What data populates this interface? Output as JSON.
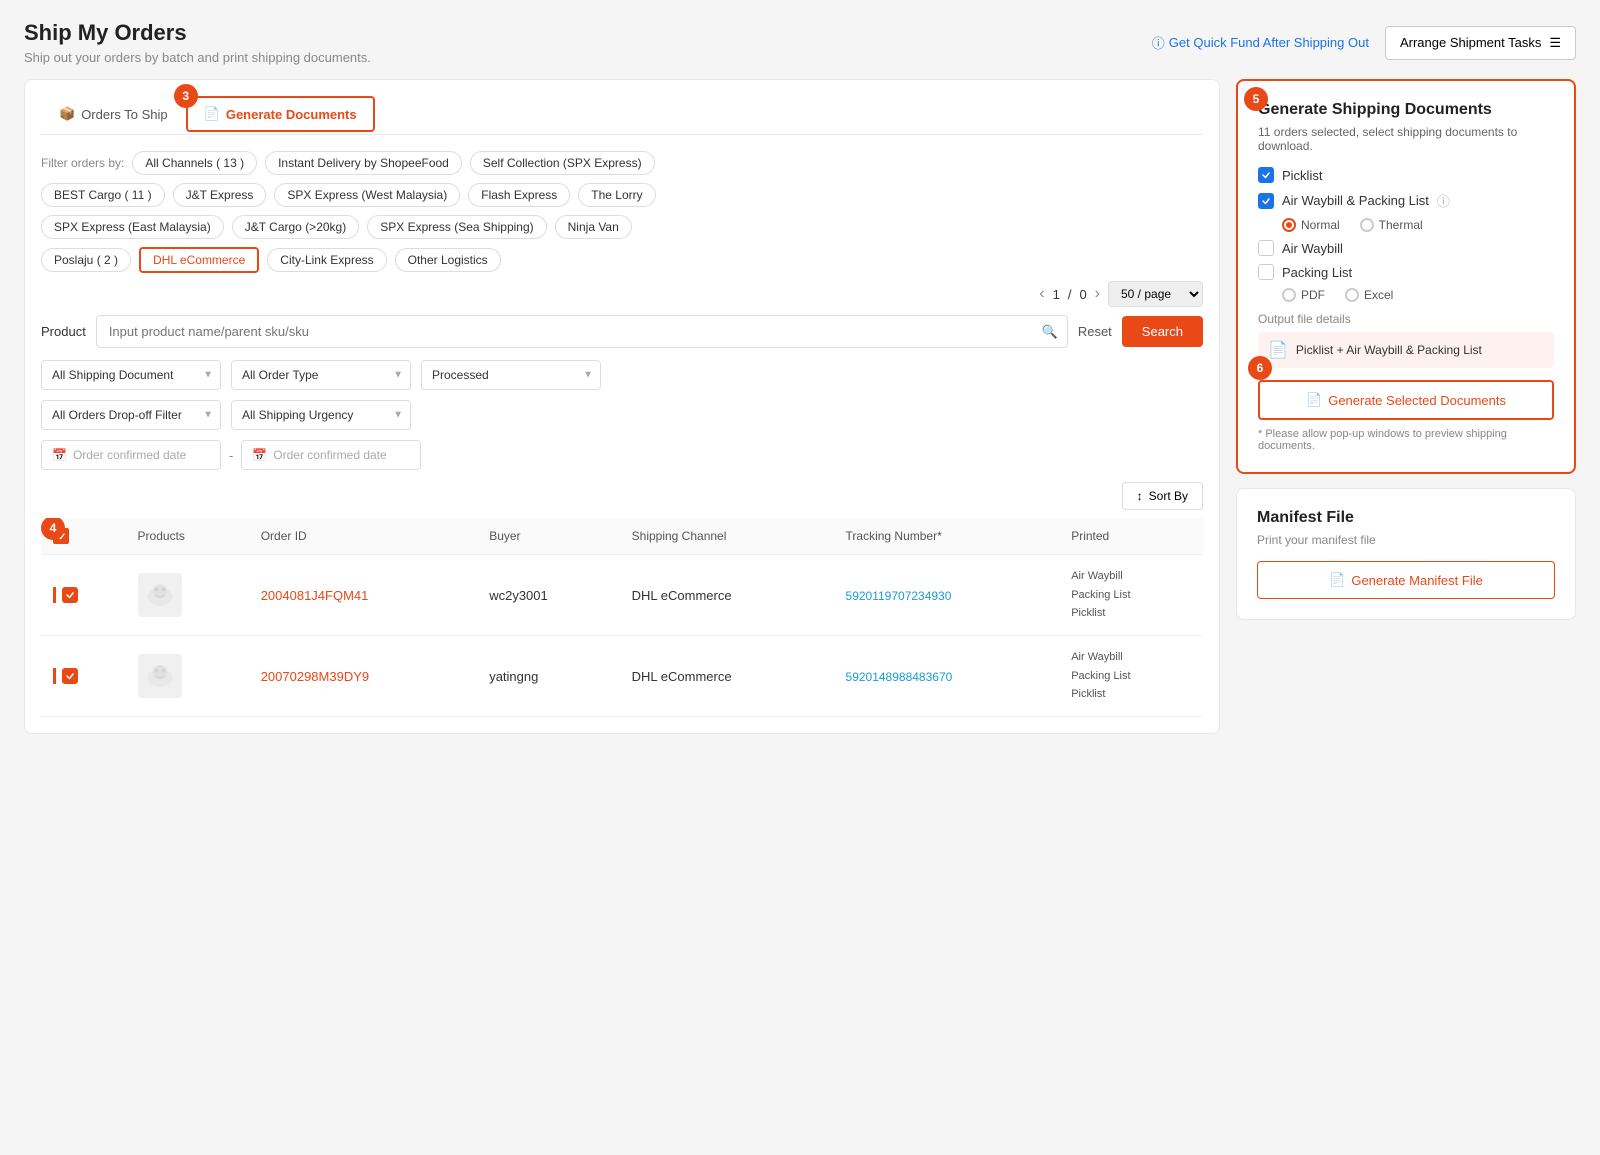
{
  "page": {
    "title": "Ship My Orders",
    "subtitle": "Ship out your orders by batch and print shipping documents.",
    "get_quick_fund": "Get Quick Fund After Shipping Out",
    "arrange_btn": "Arrange Shipment Tasks"
  },
  "tabs": [
    {
      "id": "orders-to-ship",
      "label": "Orders To Ship",
      "icon": "box-icon",
      "active": false
    },
    {
      "id": "generate-documents",
      "label": "Generate Documents",
      "icon": "doc-icon",
      "active": true
    }
  ],
  "filters": {
    "label": "Filter orders by:",
    "chips": [
      {
        "label": "All Channels ( 13 )",
        "active": false
      },
      {
        "label": "Instant Delivery by ShopeeFood",
        "active": false
      },
      {
        "label": "Self Collection (SPX Express)",
        "active": false
      },
      {
        "label": "BEST Cargo ( 11 )",
        "active": false
      },
      {
        "label": "J&T Express",
        "active": false
      },
      {
        "label": "SPX Express (West Malaysia)",
        "active": false
      },
      {
        "label": "Flash Express",
        "active": false
      },
      {
        "label": "The Lorry",
        "active": false
      },
      {
        "label": "SPX Express (East Malaysia)",
        "active": false
      },
      {
        "label": "J&T Cargo (>20kg)",
        "active": false
      },
      {
        "label": "SPX Express (Sea Shipping)",
        "active": false
      },
      {
        "label": "Ninja Van",
        "active": false
      },
      {
        "label": "Poslaju ( 2 )",
        "active": false
      },
      {
        "label": "DHL eCommerce",
        "active": true
      },
      {
        "label": "City-Link Express",
        "active": false
      },
      {
        "label": "Other Logistics",
        "active": false
      }
    ]
  },
  "pagination": {
    "current": "1",
    "total": "0",
    "per_page": "50 / page"
  },
  "search": {
    "label": "Product",
    "placeholder": "Input product name/parent sku/sku",
    "reset_label": "Reset",
    "search_label": "Search"
  },
  "dropdowns": {
    "shipping_doc": "All Shipping Document",
    "order_type": "All Order Type",
    "status": "Processed",
    "dropoff_filter": "All Orders Drop-off Filter",
    "shipping_urgency": "All Shipping Urgency"
  },
  "date": {
    "from_placeholder": "Order confirmed date",
    "to_placeholder": "Order confirmed date"
  },
  "sort_label": "Sort By",
  "table": {
    "headers": [
      "",
      "Products",
      "Order ID",
      "Buyer",
      "Shipping Channel",
      "Tracking Number*",
      "Printed"
    ],
    "rows": [
      {
        "id": "row-1",
        "order_id": "2004081J4FQM41",
        "buyer": "wc2y3001",
        "channel": "DHL eCommerce",
        "tracking": "5920119707234930",
        "printed": [
          "Air Waybill",
          "Packing List",
          "Picklist"
        ],
        "has_image": true
      },
      {
        "id": "row-2",
        "order_id": "20070298M39DY9",
        "buyer": "yatingng",
        "channel": "DHL eCommerce",
        "tracking": "5920148988483670",
        "printed": [
          "Air Waybill",
          "Packing List",
          "Picklist"
        ],
        "has_image": true
      }
    ]
  },
  "right_panel": {
    "gen_docs": {
      "title": "Generate Shipping Documents",
      "subtitle": "11 orders selected, select shipping documents to download.",
      "options": [
        {
          "id": "picklist",
          "label": "Picklist",
          "checked": true
        },
        {
          "id": "air-waybill-packing",
          "label": "Air Waybill & Packing List",
          "checked": true,
          "has_info": true,
          "suboptions": [
            {
              "id": "normal",
              "label": "Normal",
              "selected": true
            },
            {
              "id": "thermal",
              "label": "Thermal",
              "selected": false
            }
          ]
        },
        {
          "id": "air-waybill",
          "label": "Air Waybill",
          "checked": false
        },
        {
          "id": "packing-list",
          "label": "Packing List",
          "checked": false,
          "suboptions_format": [
            {
              "id": "pdf",
              "label": "PDF",
              "selected": false
            },
            {
              "id": "excel",
              "label": "Excel",
              "selected": false
            }
          ]
        }
      ],
      "output_label": "Output file details",
      "output_file": "Picklist + Air Waybill & Packing List",
      "generate_btn": "Generate Selected Documents",
      "popup_note": "* Please allow pop-up windows to preview shipping documents."
    },
    "manifest": {
      "title": "Manifest File",
      "subtitle": "Print your manifest file",
      "generate_btn": "Generate Manifest File"
    }
  },
  "step_badges": {
    "step3": "3",
    "step4": "4",
    "step5": "5",
    "step6": "6"
  }
}
